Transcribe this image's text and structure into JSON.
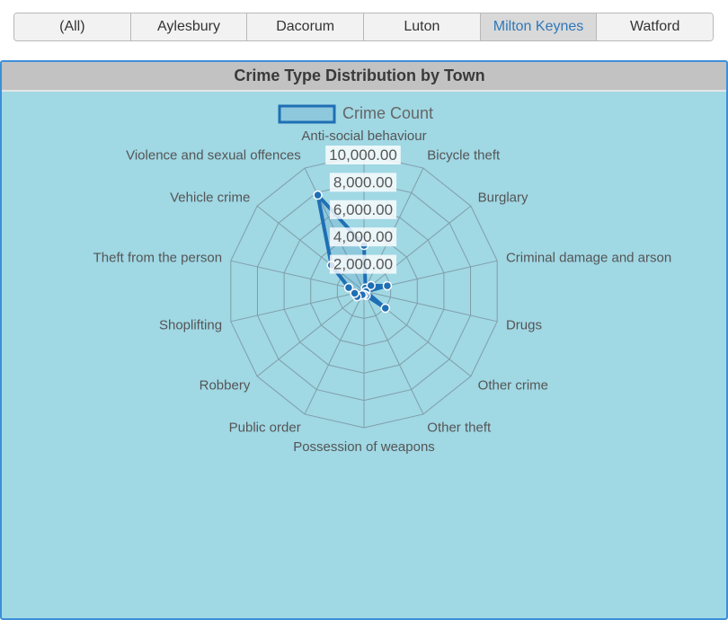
{
  "tabs": [
    {
      "label": "(All)",
      "active": false
    },
    {
      "label": "Aylesbury",
      "active": false
    },
    {
      "label": "Dacorum",
      "active": false
    },
    {
      "label": "Luton",
      "active": false
    },
    {
      "label": "Milton Keynes",
      "active": true
    },
    {
      "label": "Watford",
      "active": false
    }
  ],
  "panel": {
    "title": "Crime Type Distribution by Town"
  },
  "colors": {
    "series": "#1f6fb4",
    "grid": "#7f9ea8",
    "panel_bg": "#a0d8e4"
  },
  "chart_data": {
    "type": "radar",
    "title": "Crime Type Distribution by Town",
    "legend": {
      "position": "top"
    },
    "series": [
      {
        "name": "Crime Count",
        "values": [
          3350,
          250,
          650,
          1750,
          150,
          2000,
          350,
          250,
          300,
          650,
          700,
          1150,
          3050,
          7800
        ]
      }
    ],
    "categories": [
      "Anti-social behaviour",
      "Bicycle theft",
      "Burglary",
      "Criminal damage and arson",
      "Drugs",
      "Other crime",
      "Other theft",
      "Possession of weapons",
      "Public order",
      "Robbery",
      "Shoplifting",
      "Theft from the person",
      "Vehicle crime",
      "Violence and sexual offences"
    ],
    "r_ticks": [
      "2,000.00",
      "4,000.00",
      "6,000.00",
      "8,000.00",
      "10,000.00"
    ],
    "r_tick_values": [
      2000,
      4000,
      6000,
      8000,
      10000
    ],
    "rlim": [
      0,
      10000
    ]
  }
}
